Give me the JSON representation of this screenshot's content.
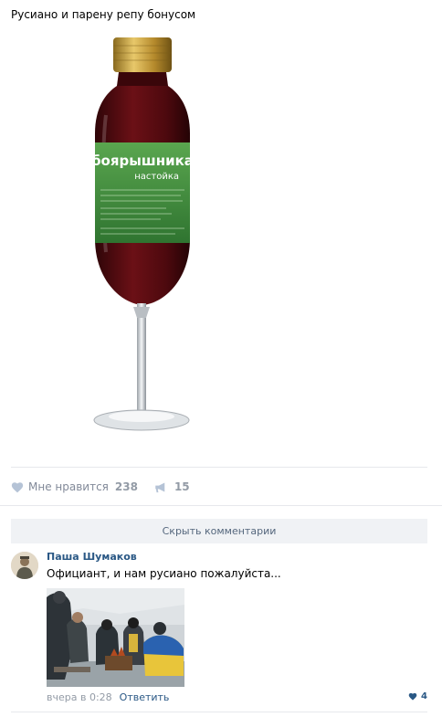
{
  "post": {
    "text": "Русиано и парену репу бонусом",
    "label_text": "боярышника",
    "label_sub": "настойка"
  },
  "actions": {
    "like_label": "Мне нравится",
    "like_count": "238",
    "share_count": "15"
  },
  "comments_toggle": "Скрыть комментарии",
  "comment": {
    "author": "Паша Шумаков",
    "text": "Официант, и нам русиано пожалуйста...",
    "time": "вчера в 0:28",
    "reply": "Ответить",
    "likes": "4"
  },
  "colors": {
    "link": "#2a5885",
    "muted": "#828a99",
    "liquid": "#5e0d12",
    "label_green": "#3f8a3c"
  }
}
